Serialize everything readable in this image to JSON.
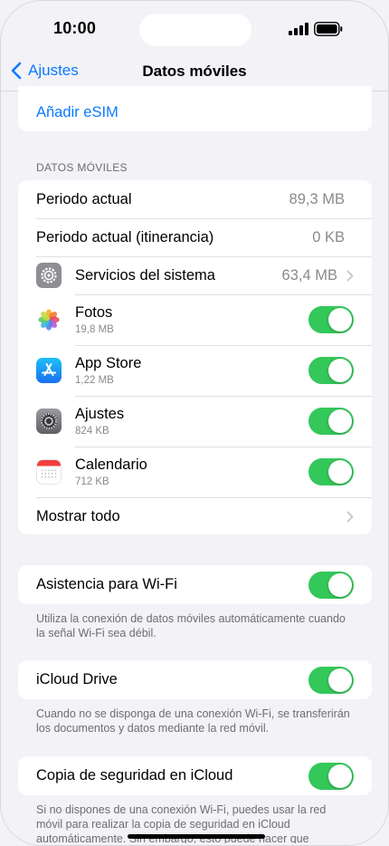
{
  "status": {
    "time": "10:00"
  },
  "nav": {
    "back_label": "Ajustes",
    "title": "Datos móviles"
  },
  "top_group": {
    "add_esim": "Añadir eSIM"
  },
  "mobile_data": {
    "header": "DATOS MÓVILES",
    "current_period": {
      "label": "Periodo actual",
      "value": "89,3 MB"
    },
    "roaming_period": {
      "label": "Periodo actual (itinerancia)",
      "value": "0 KB"
    },
    "system_services": {
      "label": "Servicios del sistema",
      "value": "63,4 MB"
    },
    "apps": [
      {
        "name": "Fotos",
        "size": "19,8 MB",
        "icon": "photos-icon",
        "enabled": true
      },
      {
        "name": "App Store",
        "size": "1,22 MB",
        "icon": "app-store-icon",
        "enabled": true
      },
      {
        "name": "Ajustes",
        "size": "824 KB",
        "icon": "settings-icon",
        "enabled": true
      },
      {
        "name": "Calendario",
        "size": "712 KB",
        "icon": "calendar-icon",
        "enabled": true
      }
    ],
    "show_all": "Mostrar todo"
  },
  "wifi_assist": {
    "label": "Asistencia para Wi-Fi",
    "enabled": true,
    "footnote": "Utiliza la conexión de datos móviles automáticamente cuando la señal Wi-Fi sea débil."
  },
  "icloud_drive": {
    "label": "iCloud Drive",
    "enabled": true,
    "footnote": "Cuando no se disponga de una conexión Wi-Fi, se transferirán los documentos y datos mediante la red móvil."
  },
  "icloud_backup": {
    "label": "Copia de seguridad en iCloud",
    "enabled": true,
    "footnote": "Si no dispones de una conexión Wi-Fi, puedes usar la red móvil para realizar la copia de seguridad en iCloud automáticamente. Sin embargo, esto puede hacer que"
  },
  "colors": {
    "accent": "#0a7aff",
    "toggle_on": "#34c759",
    "background": "#f2f2f7"
  }
}
